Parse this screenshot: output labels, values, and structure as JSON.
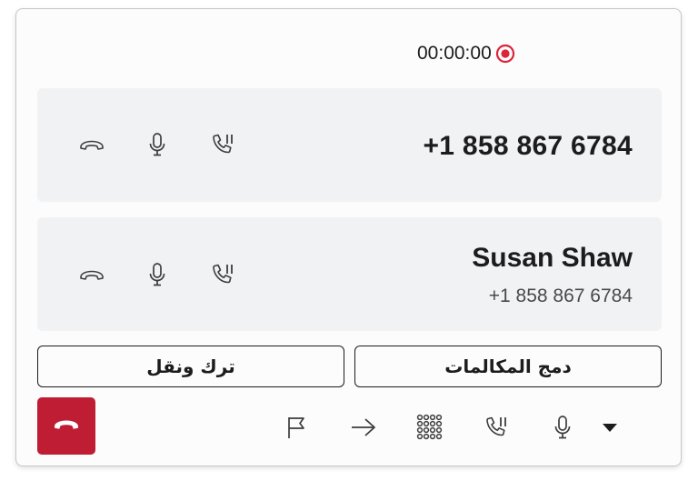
{
  "timer": {
    "elapsed": "00:00:00",
    "recording_icon": "record-icon"
  },
  "calls": [
    {
      "number": "+1 858 867 6784",
      "actions": [
        "hang-up-icon",
        "microphone-icon",
        "hold-call-icon"
      ]
    },
    {
      "name": "Susan Shaw",
      "number": "+1 858 867 6784",
      "actions": [
        "hang-up-icon",
        "microphone-icon",
        "hold-call-icon"
      ]
    }
  ],
  "buttons": {
    "leave_transfer": "ترك ونقل",
    "merge_calls": "دمج المكالمات"
  },
  "toolbar": [
    "flag-icon",
    "arrow-right-icon",
    "dialpad-icon",
    "hold-call-icon",
    "microphone-icon",
    "caret-down-icon"
  ],
  "hangup_icon": "hang-up-icon",
  "colors": {
    "hangup": "#bf1d34",
    "recording": "#d8263b",
    "card_bg": "#f1f2f4"
  }
}
